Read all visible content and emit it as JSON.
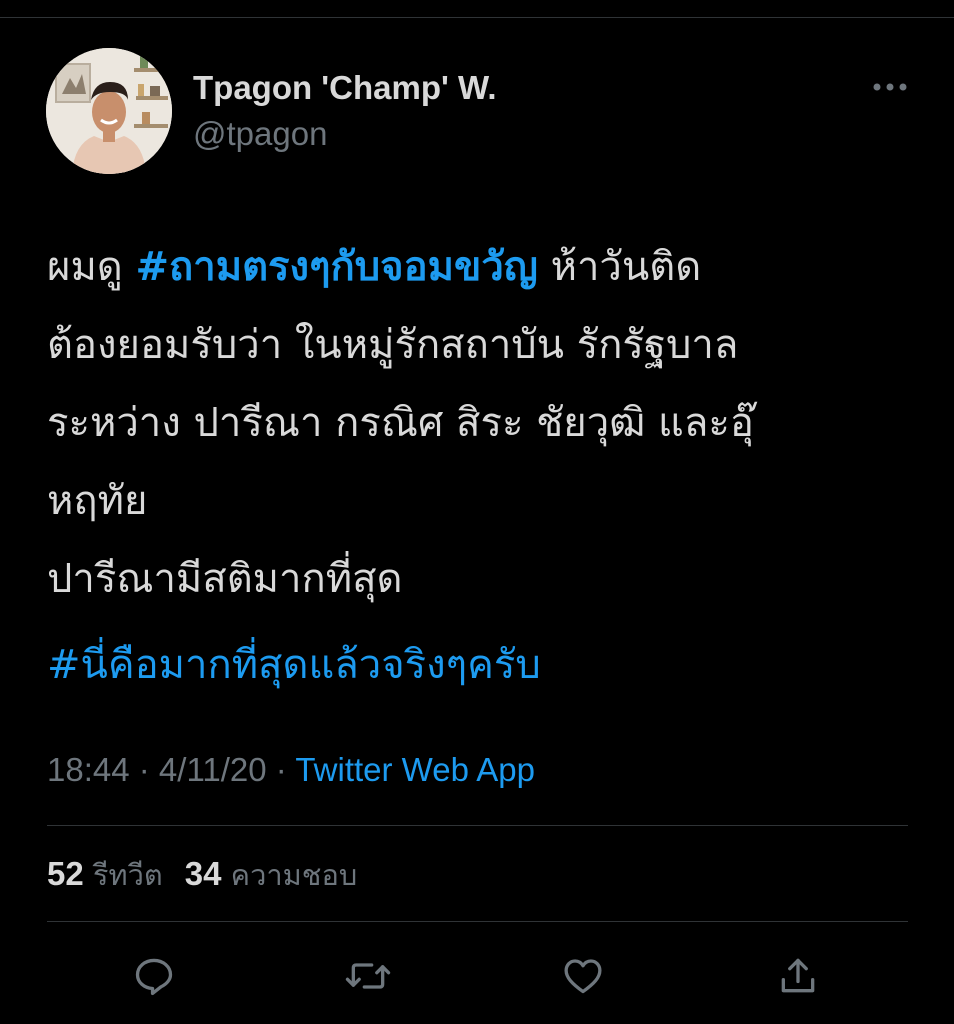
{
  "tweet": {
    "author": {
      "display_name": "Tpagon 'Champ' W.",
      "handle": "@tpagon"
    },
    "text": {
      "line1_prefix": "ผมดู ",
      "line1_hashtag": "#ถามตรงๆกับจอมขวัญ",
      "line1_suffix": " ห้าวันติด",
      "line2": "ต้องยอมรับว่า  ในหมู่รักสถาบัน รักรัฐบาล",
      "line3": "ระหว่าง ปารีณา กรณิศ สิระ ชัยวุฒิ และอุ๊",
      "line4": "หฤทัย",
      "line5": "ปารีณามีสติมากที่สุด",
      "hashtag2": "#นี่คือมากที่สุดแล้วจริงๆครับ"
    },
    "meta": {
      "time": "18:44",
      "separator1": " · ",
      "date": "4/11/20",
      "separator2": " · ",
      "source": "Twitter Web App"
    },
    "stats": {
      "retweets_count": "52",
      "retweets_label": " รีทวีต",
      "likes_count": "34",
      "likes_label": " ความชอบ"
    },
    "actions": [
      "reply-icon",
      "retweet-icon",
      "like-icon",
      "share-icon"
    ]
  },
  "colors": {
    "background": "#000000",
    "text": "#d9d9d9",
    "secondary": "#6e767d",
    "accent": "#1d9bf0",
    "divider": "#2f3336"
  }
}
